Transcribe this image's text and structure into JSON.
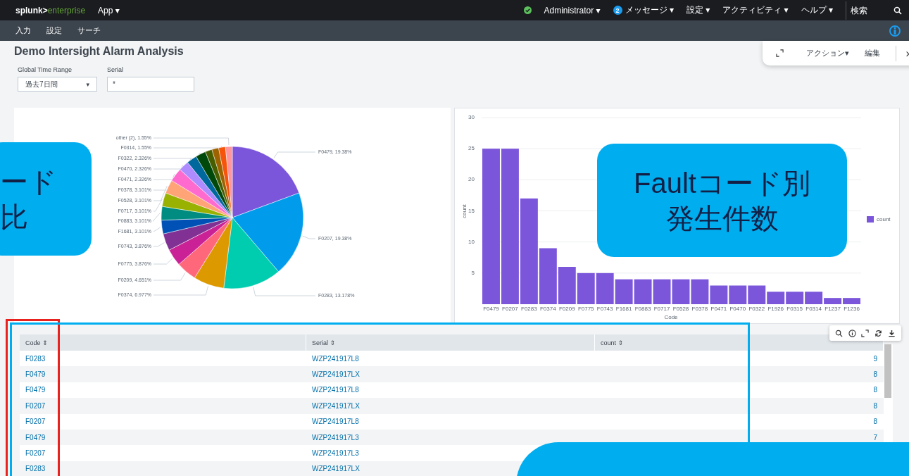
{
  "top_bar": {
    "brand": "splunk>",
    "product": "enterprise",
    "app_menu": "App ▾",
    "user": "Administrator ▾",
    "messages_badge": "2",
    "messages": "メッセージ ▾",
    "settings": "設定 ▾",
    "activity": "アクティビティ ▾",
    "help": "ヘルプ ▾",
    "search_placeholder": "検索"
  },
  "app_bar": {
    "items": [
      {
        "label": "入力"
      },
      {
        "label": "設定"
      },
      {
        "label": "サーチ"
      }
    ]
  },
  "dashboard": {
    "title": "Demo Intersight Alarm Analysis",
    "actions": "アクション▾",
    "edit": "編集",
    "chevron": "›"
  },
  "filters": [
    {
      "label": "Global Time Range",
      "kind": "dropdown",
      "value": "過去7日間",
      "caret": "▾"
    },
    {
      "label": "Serial",
      "kind": "text",
      "value": "*"
    }
  ],
  "pie_panel": {
    "chart_data": {
      "type": "pie",
      "values": [
        19.38,
        19.38,
        13.178,
        6.977,
        4.651,
        3.876,
        3.876,
        3.101,
        3.101,
        3.101,
        3.101,
        3.101,
        2.326,
        2.326,
        2.326,
        1.55,
        1.55,
        1.55,
        1.55
      ],
      "colors": [
        "#7b56db",
        "#009ceb",
        "#00cdaf",
        "#dd9900",
        "#ff677b",
        "#cb2196",
        "#813193",
        "#0051b5",
        "#008c80",
        "#99b100",
        "#ffa476",
        "#ff6ace",
        "#ae8cff",
        "#00689d",
        "#00490a",
        "#465d00",
        "#9d6300",
        "#f6540b",
        "#ff969e"
      ],
      "value_labels": [
        "F0479, 19.38%",
        "F0207, 19.38%",
        "F0283, 13.178%",
        "F0374, 6.977%",
        "F0209, 4.651%",
        "F0775, 3.876%",
        "F0743, 3.876%",
        "F1681, 3.101%",
        "F0883, 3.101%",
        "F0717, 3.101%",
        "F0528, 3.101%",
        "F0378, 3.101%",
        "F0471, 2.326%",
        "F0470, 2.326%",
        "F0322, 2.326%",
        null,
        null,
        "F0314, 1.55%",
        "other (2), 1.55%"
      ]
    }
  },
  "bar_panel": {
    "chart_data": {
      "type": "bar",
      "xlabel": "Code",
      "ylabel": "count",
      "categories": [
        "F0479",
        "F0207",
        "F0283",
        "F0374",
        "F0209",
        "F0775",
        "F0743",
        "F1681",
        "F0883",
        "F0717",
        "F0528",
        "F0378",
        "F0471",
        "F0470",
        "F0322",
        "F1926",
        "F0315",
        "F0314",
        "F1237",
        "F1236"
      ],
      "series": [
        {
          "name": "count",
          "color": "#7b56db",
          "values": [
            25,
            25,
            17,
            9,
            6,
            5,
            5,
            4,
            4,
            4,
            4,
            4,
            3,
            3,
            3,
            2,
            2,
            2,
            1,
            1
          ]
        }
      ],
      "ylim": [
        0,
        30
      ],
      "yticks": [
        5,
        10,
        15,
        20,
        25,
        30
      ],
      "grid": true
    }
  },
  "table": {
    "columns": [
      {
        "label": "Code ⇕"
      },
      {
        "label": "Serial ⇕"
      },
      {
        "label": "count ⇕"
      }
    ],
    "rows": [
      {
        "code": "F0283",
        "serial": "WZP241917L8",
        "count": "9"
      },
      {
        "code": "F0479",
        "serial": "WZP241917LX",
        "count": "8"
      },
      {
        "code": "F0479",
        "serial": "WZP241917L8",
        "count": "8"
      },
      {
        "code": "F0207",
        "serial": "WZP241917LX",
        "count": "8"
      },
      {
        "code": "F0207",
        "serial": "WZP241917L8",
        "count": "8"
      },
      {
        "code": "F0479",
        "serial": "WZP241917L3",
        "count": "7"
      },
      {
        "code": "F0207",
        "serial": "WZP241917L3"
      },
      {
        "code": "F0283",
        "serial": "WZP241917LX"
      }
    ]
  },
  "annotations": [
    {
      "kind": "callout",
      "lines": [
        "ード",
        "比"
      ]
    },
    {
      "kind": "callout",
      "lines": [
        "Faultコード別",
        "発生件数"
      ]
    },
    {
      "kind": "frame",
      "color": "#e8231f"
    },
    {
      "kind": "frame",
      "color": "#00aeef"
    },
    {
      "kind": "blank-callout"
    }
  ]
}
